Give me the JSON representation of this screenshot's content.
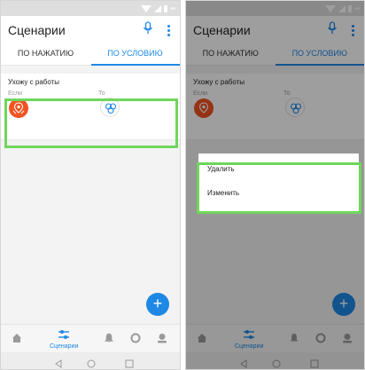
{
  "app": {
    "title": "Сценарии",
    "tabs": [
      "ПО НАЖАТИЮ",
      "ПО УСЛОВИЮ"
    ],
    "active_tab": 1,
    "accent_color": "#1e88e5"
  },
  "rule": {
    "name": "Ухожу с работы",
    "if_label": "Если",
    "to_label": "То",
    "if_icon": "location-exit-icon",
    "to_icon": "scene-devices-icon"
  },
  "fab": {
    "label": "+"
  },
  "bottom_nav": {
    "items": [
      "home-icon",
      "scenarios-icon",
      "notifications-icon",
      "devices-icon",
      "profile-icon"
    ],
    "active_label": "Сценарии"
  },
  "context_menu": {
    "items": [
      "Удалить",
      "Изменить"
    ]
  },
  "highlight_color": "#6fd65d",
  "icon_colors": {
    "if": "#f25322",
    "to": "#1e88e5"
  }
}
